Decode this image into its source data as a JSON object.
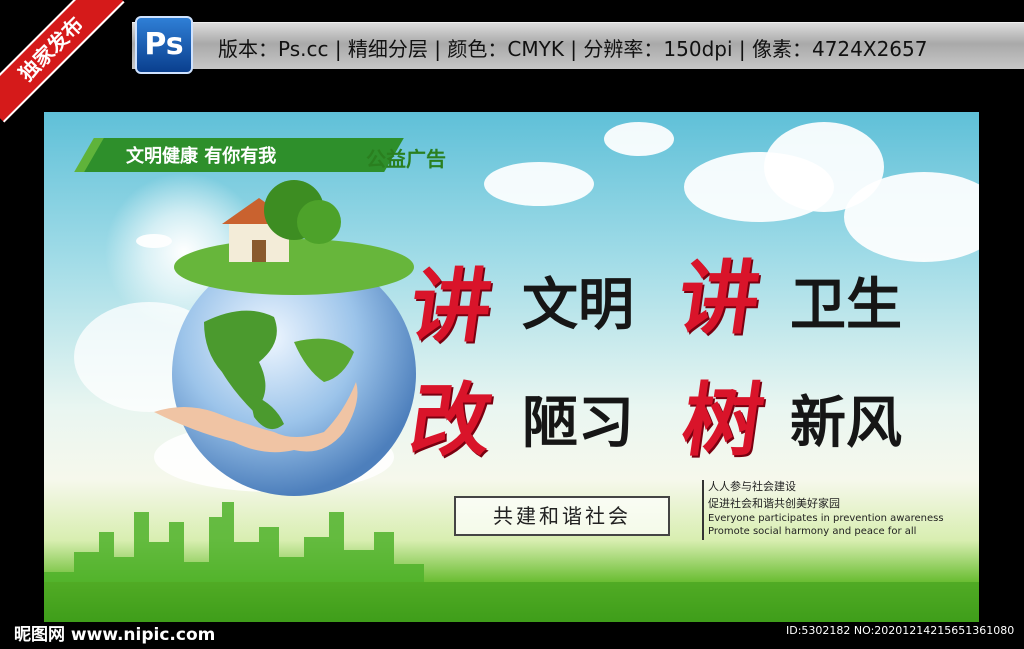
{
  "header": {
    "ribbon_label": "独家发布",
    "ps_icon_label": "Ps",
    "info_line": "版本：Ps.cc | 精细分层 | 颜色：CMYK | 分辨率：150dpi | 像素：4724X2657"
  },
  "poster": {
    "tag_band_text": "文明健康  有你有我",
    "tag_right_text": "公益广告",
    "slogan": {
      "row1": {
        "red1": "讲",
        "black1": "文明",
        "red2": "讲",
        "black2": "卫生"
      },
      "row2": {
        "red1": "改",
        "black1": "陋习",
        "red2": "树",
        "black2": "新风"
      }
    },
    "coop_box": "共建和谐社会",
    "side_lines": [
      "人人参与社会建设",
      "促进社会和谐共创美好家园",
      "Everyone participates in prevention awareness",
      "Promote social harmony and peace for all"
    ]
  },
  "footer": {
    "watermark_left": "昵图网 www.nipic.com",
    "id_text": "ID:5302182 NO:20201214215651361080"
  },
  "colors": {
    "accent_red": "#d9142a",
    "band_green": "#2e8f2b",
    "ribbon_red": "#d51a1a"
  }
}
